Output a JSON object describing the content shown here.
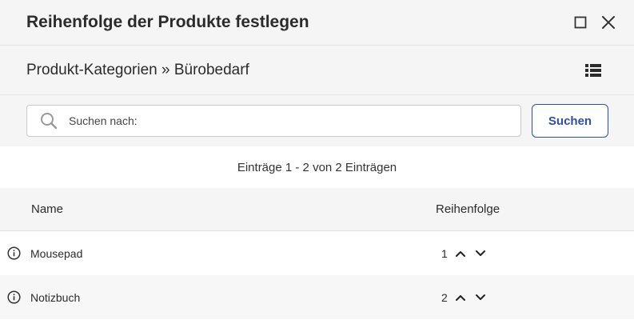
{
  "dialog": {
    "title": "Reihenfolge der Produkte festlegen",
    "maximize_icon": "maximize-icon",
    "close_icon": "close-icon"
  },
  "breadcrumb": {
    "text": "Produkt-Kategorien » Bürobedarf",
    "list_view_icon": "list-view-icon"
  },
  "search": {
    "placeholder": "Suchen nach:",
    "value": "",
    "button_label": "Suchen",
    "accent_color": "#2c4fa8"
  },
  "entries_info": "Einträge 1 - 2 von 2 Einträgen",
  "table": {
    "columns": [
      "Name",
      "Reihenfolge"
    ],
    "rows": [
      {
        "name": "Mousepad",
        "order": "1"
      },
      {
        "name": "Notizbuch",
        "order": "2"
      }
    ]
  }
}
